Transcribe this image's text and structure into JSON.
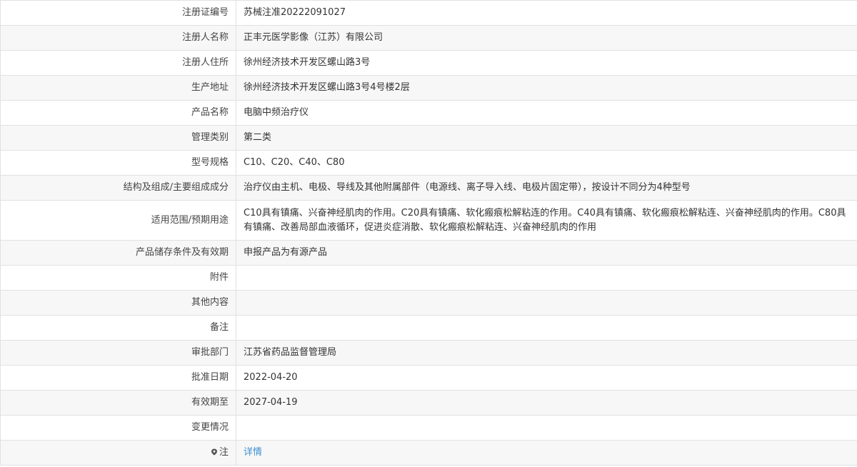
{
  "rows": [
    {
      "label": "注册证编号",
      "value": "苏械注准20222091027"
    },
    {
      "label": "注册人名称",
      "value": "正丰元医学影像（江苏）有限公司"
    },
    {
      "label": "注册人住所",
      "value": "徐州经济技术开发区螺山路3号"
    },
    {
      "label": "生产地址",
      "value": "徐州经济技术开发区螺山路3号4号楼2层"
    },
    {
      "label": "产品名称",
      "value": "电脑中频治疗仪"
    },
    {
      "label": "管理类别",
      "value": "第二类"
    },
    {
      "label": "型号规格",
      "value": "C10、C20、C40、C80"
    },
    {
      "label": "结构及组成/主要组成成分",
      "value": "治疗仪由主机、电极、导线及其他附属部件（电源线、离子导入线、电极片固定带），按设计不同分为4种型号"
    },
    {
      "label": "适用范围/预期用途",
      "value": "C10具有镇痛、兴奋神经肌肉的作用。C20具有镇痛、软化瘢痕松解粘连的作用。C40具有镇痛、软化瘢痕松解粘连、兴奋神经肌肉的作用。C80具有镇痛、改善局部血液循环，促进炎症消散、软化瘢痕松解粘连、兴奋神经肌肉的作用"
    },
    {
      "label": "产品储存条件及有效期",
      "value": "申报产品为有源产品"
    },
    {
      "label": "附件",
      "value": ""
    },
    {
      "label": "其他内容",
      "value": ""
    },
    {
      "label": "备注",
      "value": ""
    },
    {
      "label": "审批部门",
      "value": "江苏省药品监督管理局"
    },
    {
      "label": "批准日期",
      "value": "2022-04-20"
    },
    {
      "label": "有效期至",
      "value": "2027-04-19"
    },
    {
      "label": "变更情况",
      "value": ""
    }
  ],
  "note": {
    "label": "注",
    "icon": "map-pin-icon",
    "link_text": "详情",
    "link_color": "#3b8fd1"
  }
}
